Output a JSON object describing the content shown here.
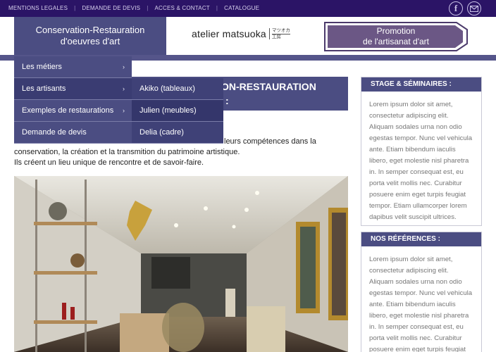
{
  "topbar": {
    "links": [
      "MENTIONS LEGALES",
      "DEMANDE DE DEVIS",
      "ACCES & CONTACT",
      "CATALOGUE"
    ],
    "separator": "|",
    "social": [
      {
        "icon": "facebook-icon",
        "glyph": "f"
      },
      {
        "icon": "mail-icon",
        "glyph": "✉"
      }
    ]
  },
  "header": {
    "brand_line1": "Conservation-Restauration",
    "brand_line2": "d'oeuvres d'art",
    "logo_text": "atelier matsuoka",
    "logo_jp_line1": "マツオカ",
    "logo_jp_line2": "工房",
    "promo_line1": "Promotion",
    "promo_line2": "de l'artisanat d'art"
  },
  "main": {
    "title_line1": "ON-RESTAURATION",
    "title_line2": ":",
    "text_line1": "leurs compétences dans la",
    "text_line2": "conservation, la création et la transmition du patrimoine artistique.",
    "text_line3": "Ils créent un lieu unique de rencontre et de savoir-faire."
  },
  "menu": {
    "items": [
      {
        "label": "Les métiers",
        "chevron": "›"
      },
      {
        "label": "Les artisants",
        "chevron": "›"
      },
      {
        "label": "Exemples de restaurations",
        "chevron": "›"
      },
      {
        "label": "Demande de devis",
        "chevron": ""
      }
    ],
    "submenu": [
      {
        "label": "Akiko (tableaux)"
      },
      {
        "label": "Julien (meubles)"
      },
      {
        "label": "Delia (cadre)"
      }
    ]
  },
  "sidebar": {
    "stage_title": "STAGE & SÉMINAIRES :",
    "stage_text": "Lorem ipsum dolor sit amet, consectetur adipiscing elit. Aliquam sodales urna non odio egestas tempor. Nunc vel vehicula ante. Etiam bibendum iaculis libero, eget molestie nisl pharetra in. In semper consequat est, eu porta velit mollis nec. Curabitur posuere enim eget turpis feugiat tempor. Etiam ullamcorper lorem dapibus velit suscipit ultrices.",
    "refs_title": "NOS RÉFÉRENCES :",
    "refs_text": "Lorem ipsum dolor sit amet, consectetur adipiscing elit. Aliquam sodales urna non odio egestas tempor. Nunc vel vehicula ante. Etiam bibendum iaculis libero, eget molestie nisl pharetra in. In semper consequat est, eu porta velit mollis nec. Curabitur posuere enim eget turpis feugiat tempor. Etiam"
  },
  "colors": {
    "topbar": "#2b1466",
    "accent": "#4b4d82",
    "promo_fill": "#6b5785"
  }
}
